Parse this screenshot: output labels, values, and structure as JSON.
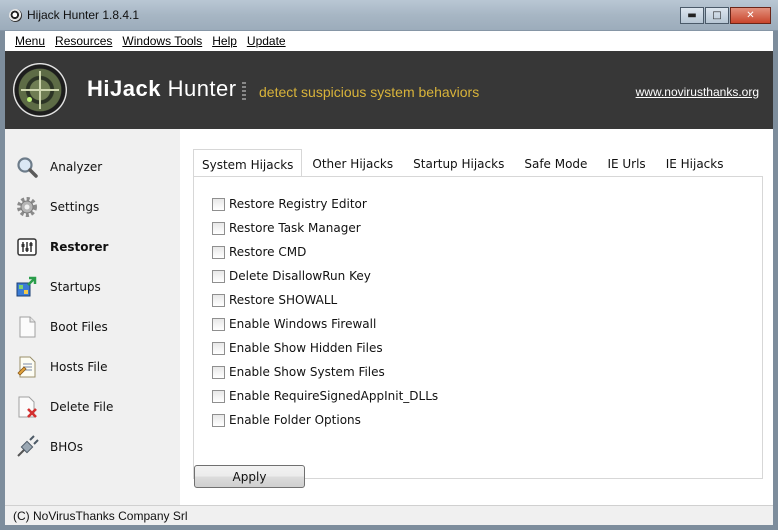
{
  "window": {
    "title": "Hijack Hunter 1.8.4.1",
    "controls": [
      "minimize",
      "maximize",
      "close"
    ]
  },
  "menubar": {
    "items": [
      "Menu",
      "Resources",
      "Windows Tools",
      "Help",
      "Update"
    ]
  },
  "banner": {
    "app_name_bold": "HiJack",
    "app_name_rest": " Hunter",
    "tagline": "detect suspicious system behaviors",
    "website": "www.novirusthanks.org",
    "tagline_color": "#d8b33a",
    "background": "#373737"
  },
  "sidebar": {
    "items": [
      {
        "label": "Analyzer",
        "icon": "magnifier-icon",
        "active": false
      },
      {
        "label": "Settings",
        "icon": "gear-icon",
        "active": false
      },
      {
        "label": "Restorer",
        "icon": "restore-icon",
        "active": true
      },
      {
        "label": "Startups",
        "icon": "startup-icon",
        "active": false
      },
      {
        "label": "Boot Files",
        "icon": "boot-file-icon",
        "active": false
      },
      {
        "label": "Hosts File",
        "icon": "hosts-file-icon",
        "active": false
      },
      {
        "label": "Delete File",
        "icon": "delete-file-icon",
        "active": false
      },
      {
        "label": "BHOs",
        "icon": "plugin-icon",
        "active": false
      }
    ]
  },
  "tabs": [
    {
      "label": "System Hijacks",
      "active": true
    },
    {
      "label": "Other Hijacks",
      "active": false
    },
    {
      "label": "Startup Hijacks",
      "active": false
    },
    {
      "label": "Safe Mode",
      "active": false
    },
    {
      "label": "IE Urls",
      "active": false
    },
    {
      "label": "IE Hijacks",
      "active": false
    }
  ],
  "options": [
    {
      "label": "Restore Registry Editor",
      "checked": false
    },
    {
      "label": "Restore Task Manager",
      "checked": false
    },
    {
      "label": "Restore CMD",
      "checked": false
    },
    {
      "label": "Delete DisallowRun Key",
      "checked": false
    },
    {
      "label": "Restore SHOWALL",
      "checked": false
    },
    {
      "label": "Enable Windows Firewall",
      "checked": false
    },
    {
      "label": "Enable Show Hidden Files",
      "checked": false
    },
    {
      "label": "Enable Show System Files",
      "checked": false
    },
    {
      "label": "Enable RequireSignedAppInit_DLLs",
      "checked": false
    },
    {
      "label": "Enable Folder Options",
      "checked": false
    }
  ],
  "apply_label": "Apply",
  "status": "(C) NoVirusThanks Company Srl"
}
